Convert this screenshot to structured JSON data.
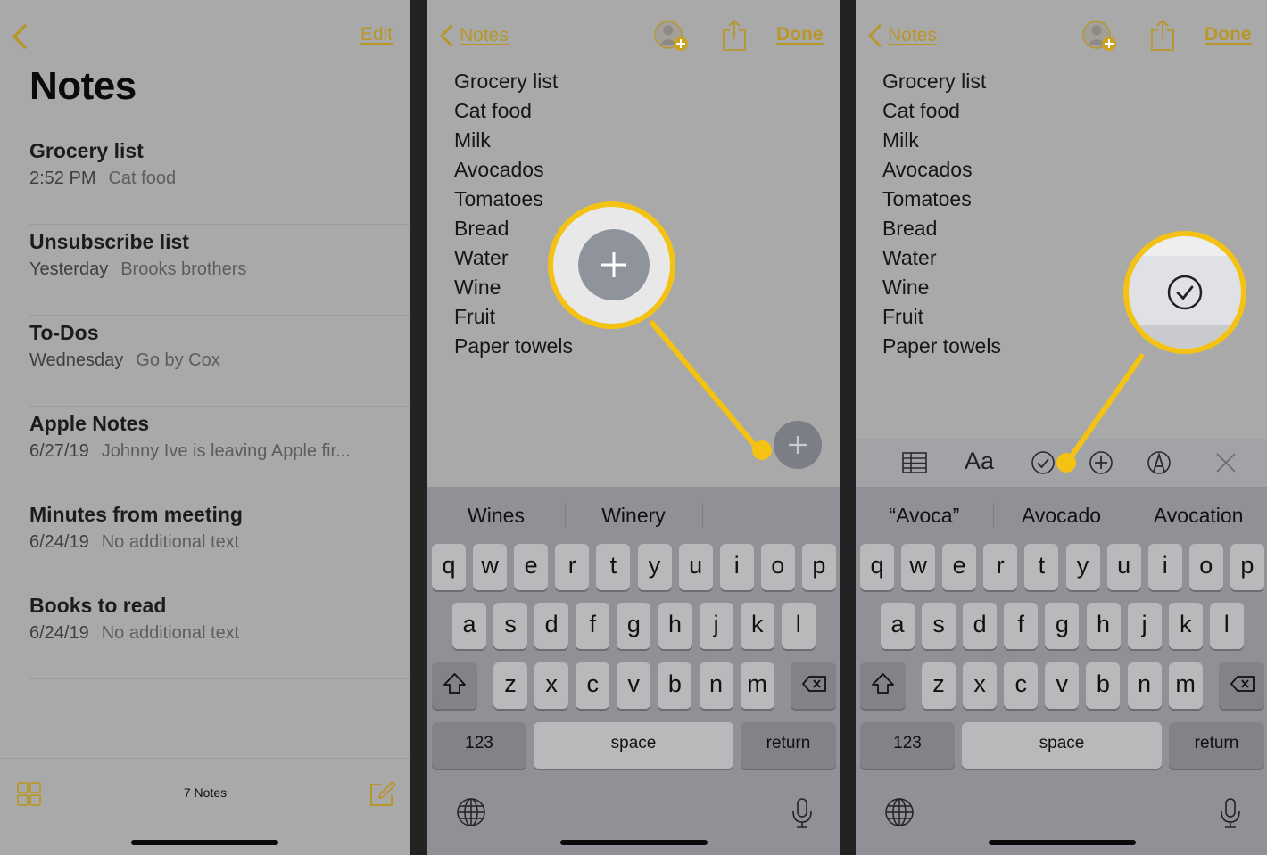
{
  "colors": {
    "accent": "#b8972a",
    "callout": "#f3c213",
    "background": "#a9a9a9",
    "keyboard": "#8f9196"
  },
  "panel1": {
    "back_icon": "chevron-left-icon",
    "edit_label": "Edit",
    "title": "Notes",
    "notes": [
      {
        "title": "Grocery list",
        "date": "2:52 PM",
        "preview": "Cat food"
      },
      {
        "title": "Unsubscribe list",
        "date": "Yesterday",
        "preview": "Brooks brothers"
      },
      {
        "title": "To-Dos",
        "date": "Wednesday",
        "preview": "Go by Cox"
      },
      {
        "title": "Apple Notes",
        "date": "6/27/19",
        "preview": "Johnny Ive is leaving Apple fir..."
      },
      {
        "title": "Minutes from meeting",
        "date": "6/24/19",
        "preview": "No additional text"
      },
      {
        "title": "Books to read",
        "date": "6/24/19",
        "preview": "No additional text"
      }
    ],
    "note_count": "7 Notes",
    "gallery_icon": "grid-icon",
    "compose_icon": "compose-icon"
  },
  "editor": {
    "back_label": "Notes",
    "done_label": "Done",
    "add_person_icon": "add-person-icon",
    "share_icon": "share-icon",
    "lines": [
      "Grocery list",
      "Cat food",
      "Milk",
      "Avocados",
      "Tomatoes",
      "Bread",
      "Water",
      "Wine",
      "Fruit",
      "Paper towels"
    ]
  },
  "panel2": {
    "suggestions": [
      "Wines",
      "Winery",
      ""
    ],
    "callout_icon": "plus-icon"
  },
  "panel3": {
    "suggestions": [
      "“Avoca”",
      "Avocado",
      "Avocation"
    ],
    "toolbar": [
      "table-icon",
      "Aa",
      "checklist-icon",
      "plus-circle-icon",
      "markup-icon",
      "close-icon"
    ],
    "format_label": "Aa",
    "callout_icon": "checklist-icon"
  },
  "keyboard": {
    "row1": [
      "q",
      "w",
      "e",
      "r",
      "t",
      "y",
      "u",
      "i",
      "o",
      "p"
    ],
    "row2": [
      "a",
      "s",
      "d",
      "f",
      "g",
      "h",
      "j",
      "k",
      "l"
    ],
    "row3": [
      "z",
      "x",
      "c",
      "v",
      "b",
      "n",
      "m"
    ],
    "numbers_label": "123",
    "space_label": "space",
    "return_label": "return"
  }
}
